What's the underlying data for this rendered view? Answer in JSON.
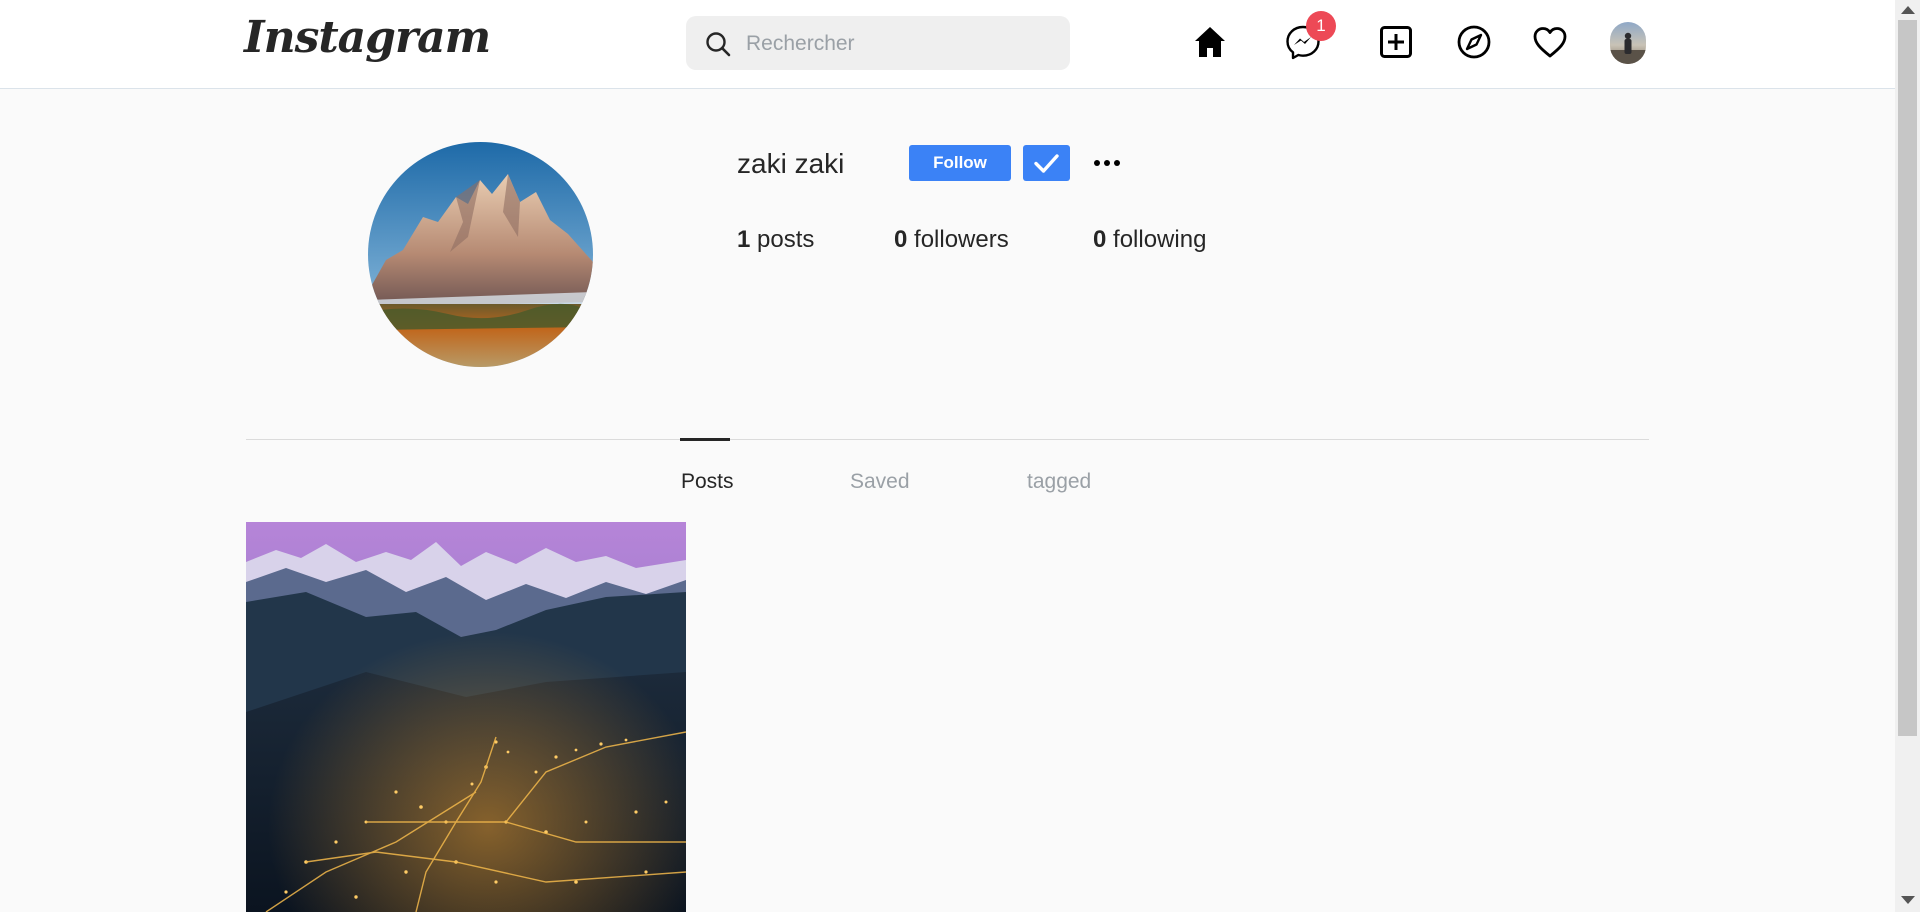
{
  "header": {
    "logo": "Instagram",
    "search": {
      "placeholder": "Rechercher",
      "value": ""
    },
    "icons": [
      "home-icon",
      "messenger-icon",
      "new-post-icon",
      "explore-icon",
      "activity-heart-icon",
      "avatar"
    ],
    "messages_badge": "1"
  },
  "profile": {
    "username": "zaki zaki",
    "follow_label": "Follow",
    "stats": [
      {
        "count": "1",
        "label": "posts"
      },
      {
        "count": "0",
        "label": "followers"
      },
      {
        "count": "0",
        "label": "following"
      }
    ]
  },
  "tabs": [
    {
      "label": "Posts",
      "active": true
    },
    {
      "label": "Saved",
      "active": false
    },
    {
      "label": "tagged",
      "active": false
    }
  ],
  "colors": {
    "accent": "#3b82f6",
    "badge": "#ed4956",
    "tab_inactive": "#9aa0a6",
    "background": "#fafafa"
  }
}
